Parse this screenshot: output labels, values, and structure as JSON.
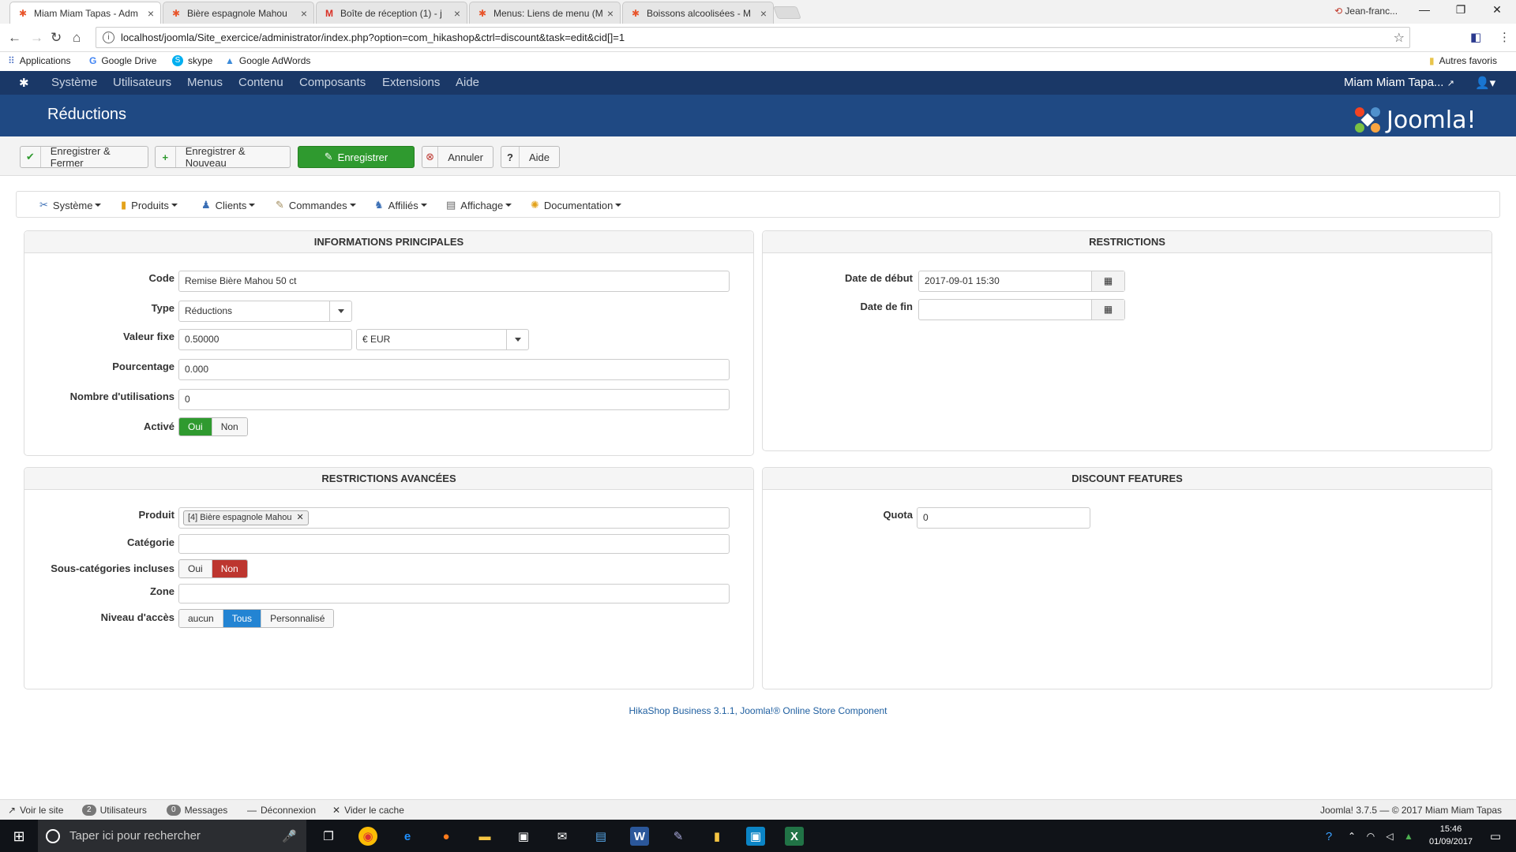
{
  "browser": {
    "tabs": [
      {
        "title": "Miam Miam Tapas - Adm",
        "icon": "joomla-favicon"
      },
      {
        "title": "Bière espagnole Mahou",
        "icon": "joomla-favicon"
      },
      {
        "title": "Boîte de réception (1) - j",
        "icon": "gmail-icon"
      },
      {
        "title": "Menus: Liens de menu (M",
        "icon": "joomla-favicon"
      },
      {
        "title": "Boissons alcoolisées - M",
        "icon": "joomla-favicon"
      }
    ],
    "user": "Jean-franc...",
    "url": "localhost/joomla/Site_exercice/administrator/index.php?option=com_hikashop&ctrl=discount&task=edit&cid[]=1",
    "bookmarks": [
      "Applications",
      "Google Drive",
      "skype",
      "Google AdWords"
    ],
    "other_bookmarks": "Autres favoris"
  },
  "joomla": {
    "menu": [
      "Système",
      "Utilisateurs",
      "Menus",
      "Contenu",
      "Composants",
      "Extensions",
      "Aide"
    ],
    "site_name": "Miam Miam Tapa...",
    "page_title": "Réductions",
    "logo_text": "Joomla!",
    "toolbar": {
      "save_close": "Enregistrer & Fermer",
      "save_new": "Enregistrer & Nouveau",
      "save": "Enregistrer",
      "cancel": "Annuler",
      "help": "Aide"
    },
    "hika_menu": [
      "Système",
      "Produits",
      "Clients",
      "Commandes",
      "Affiliés",
      "Affichage",
      "Documentation"
    ]
  },
  "main_info": {
    "title": "INFORMATIONS PRINCIPALES",
    "code_label": "Code",
    "code_value": "Remise Bière Mahou 50 ct",
    "type_label": "Type",
    "type_value": "Réductions",
    "fixed_label": "Valeur fixe",
    "fixed_value": "0.50000",
    "currency_value": "€ EUR",
    "percent_label": "Pourcentage",
    "percent_value": "0.000",
    "uses_label": "Nombre d'utilisations",
    "uses_value": "0",
    "active_label": "Activé",
    "yes": "Oui",
    "no": "Non"
  },
  "restrictions": {
    "title": "RESTRICTIONS",
    "start_label": "Date de début",
    "start_value": "2017-09-01 15:30",
    "end_label": "Date de fin",
    "end_value": ""
  },
  "advanced": {
    "title": "RESTRICTIONS AVANCÉES",
    "product_label": "Produit",
    "product_tag": "[4] Bière espagnole Mahou",
    "category_label": "Catégorie",
    "subcat_label": "Sous-catégories incluses",
    "yes": "Oui",
    "no": "Non",
    "zone_label": "Zone",
    "access_label": "Niveau d'accès",
    "access_none": "aucun",
    "access_all": "Tous",
    "access_custom": "Personnalisé"
  },
  "features": {
    "title": "DISCOUNT FEATURES",
    "quota_label": "Quota",
    "quota_value": "0"
  },
  "footer": "HikaShop Business 3.1.1, Joomla!® Online Store Component",
  "status": {
    "view_site": "Voir le site",
    "users_count": "2",
    "users": "Utilisateurs",
    "messages_count": "0",
    "messages": "Messages",
    "logout": "Déconnexion",
    "clear_cache": "Vider le cache",
    "version": "Joomla! 3.7.5 — © 2017 Miam Miam Tapas"
  },
  "taskbar": {
    "search_placeholder": "Taper ici pour rechercher",
    "time": "15:46",
    "date": "01/09/2017"
  },
  "colors": {
    "joomla_nav": "#1a3867",
    "joomla_header": "#1f4983",
    "success": "#2f9a2f",
    "danger": "#bd362f",
    "primary": "#2384d3"
  }
}
